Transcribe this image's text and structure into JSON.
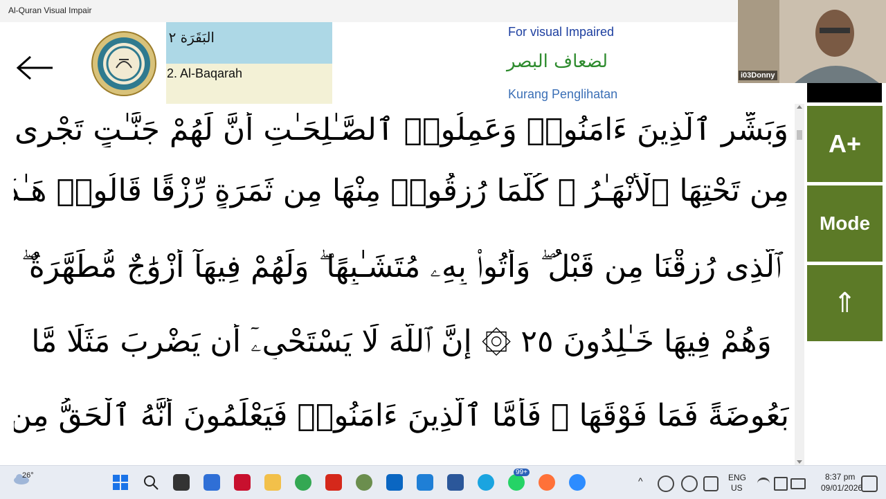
{
  "window": {
    "title": "Al-Quran Visual Impair"
  },
  "header": {
    "surah_arabic": "البَقَرَة ٢",
    "surah_english": "2. Al-Baqarah",
    "tagline_en": "For visual Impaired",
    "tagline_ar": "لضعاف البصر",
    "tagline_id": "Kurang Penglihatan"
  },
  "quran": {
    "lines": [
      "وَبَشِّرِ ٱلَّذِينَ ءَامَنُوا۟ وَعَمِلُوا۟ ٱلصَّـٰلِحَـٰتِ أَنَّ لَهُمْ جَنَّـٰتٍ تَجْرِى",
      "مِن تَحْتِهَا ٱلْأَنْهَـٰرُ ۖ كُلَّمَا رُزِقُوا۟ مِنْهَا مِن ثَمَرَةٍ رِّزْقًا قَالُوا۟ هَـٰذَا",
      "ٱلَّذِى رُزِقْنَا مِن قَبْلُ ۖ وَأُتُوا۟ بِهِۦ مُتَشَـٰبِهًا ۖ وَلَهُمْ فِيهَآ أَزْوَٰجٌ مُّطَهَّرَةٌ ۖ",
      "وَهُمْ فِيهَا خَـٰلِدُونَ ٢٥ ۞ إِنَّ ٱللَّهَ لَا يَسْتَحْىِۦٓ أَن يَضْرِبَ مَثَلًا مَّا",
      "بَعُوضَةً فَمَا فَوْقَهَا ۚ فَأَمَّا ٱلَّذِينَ ءَامَنُوا۟ فَيَعْلَمُونَ أَنَّهُ ٱلْحَقُّ مِن"
    ]
  },
  "controls": {
    "font_up": "A+",
    "mode": "Mode",
    "scroll_top": "⇑"
  },
  "webcam": {
    "name": "i03Donny"
  },
  "taskbar": {
    "temperature": "26°",
    "badge_whatsapp": "99+",
    "lang_primary": "ENG",
    "lang_secondary": "US",
    "time": "8:37 pm",
    "date": "09/01/2026"
  },
  "colors": {
    "accent_green": "#5c7a27",
    "surah_bg": "#add8e6",
    "surah_en_bg": "#f3f1d6"
  }
}
